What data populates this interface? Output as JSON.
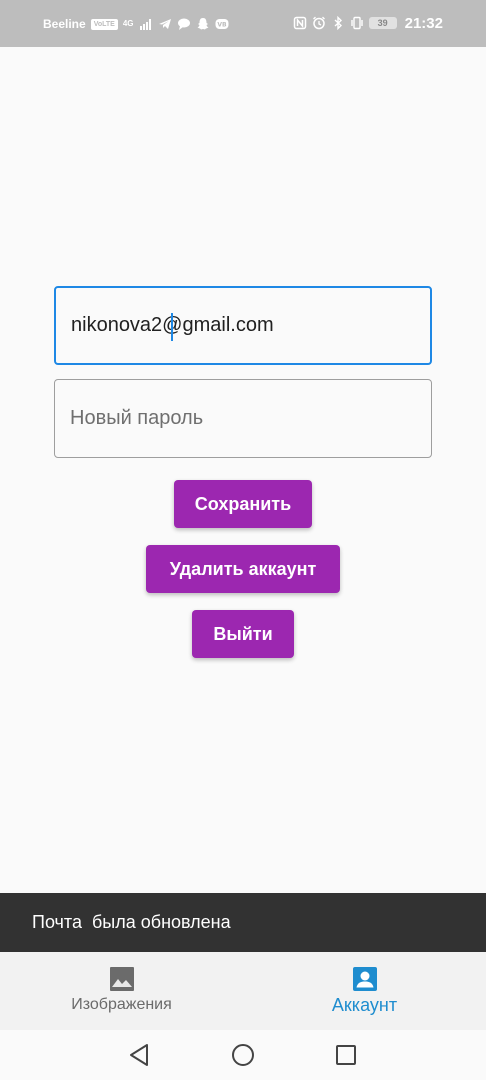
{
  "status_bar": {
    "carrier": "Beeline",
    "volte": "VoLTE",
    "network": "4G",
    "battery": "39",
    "time": "21:32"
  },
  "form": {
    "email_value": "nikonova2@gmail.com",
    "password_placeholder": "Новый пароль",
    "save_label": "Сохранить",
    "delete_label": "Удалить аккаунт",
    "logout_label": "Выйти"
  },
  "snackbar": {
    "message": "Почта  была обновлена"
  },
  "bottom_nav": {
    "items": [
      {
        "label": "Изображения",
        "icon": "image-icon",
        "active": false
      },
      {
        "label": "Аккаунт",
        "icon": "account-box-icon",
        "active": true
      }
    ]
  },
  "colors": {
    "accent_button": "#9c27b0",
    "focus_border": "#1e88e5",
    "active_tab": "#1f8dcf",
    "snackbar_bg": "#323232",
    "status_bar_bg": "#bdbdbd"
  }
}
